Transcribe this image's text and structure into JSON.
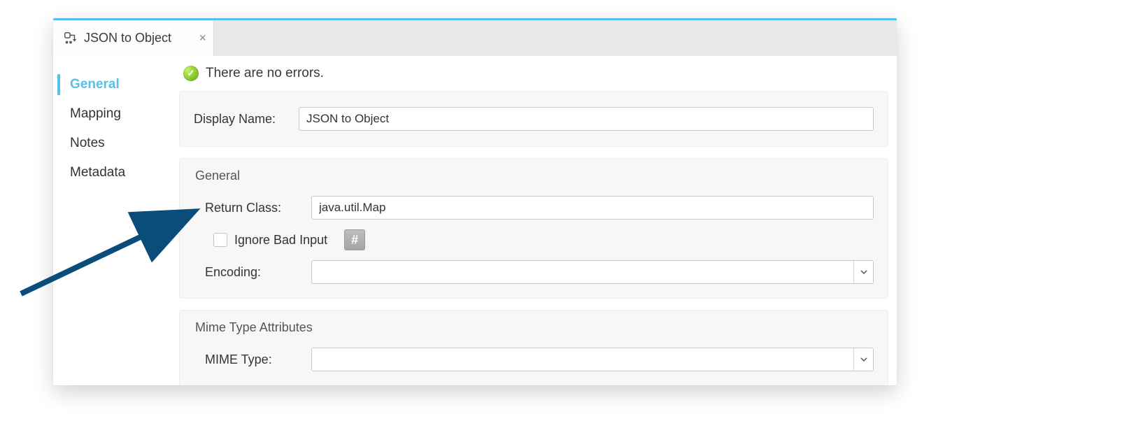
{
  "tab": {
    "title": "JSON to Object"
  },
  "status": {
    "message": "There are no errors."
  },
  "sidebar": {
    "items": [
      {
        "label": "General",
        "active": true
      },
      {
        "label": "Mapping",
        "active": false
      },
      {
        "label": "Notes",
        "active": false
      },
      {
        "label": "Metadata",
        "active": false
      }
    ]
  },
  "form": {
    "displayName": {
      "label": "Display Name:",
      "value": "JSON to Object"
    },
    "generalGroup": {
      "title": "General",
      "returnClass": {
        "label": "Return Class:",
        "value": "java.util.Map"
      },
      "ignoreBadInput": {
        "label": "Ignore Bad Input",
        "checked": false
      },
      "encoding": {
        "label": "Encoding:",
        "value": ""
      }
    },
    "mimeGroup": {
      "title": "Mime Type Attributes",
      "mimeType": {
        "label": "MIME Type:",
        "value": ""
      }
    }
  }
}
